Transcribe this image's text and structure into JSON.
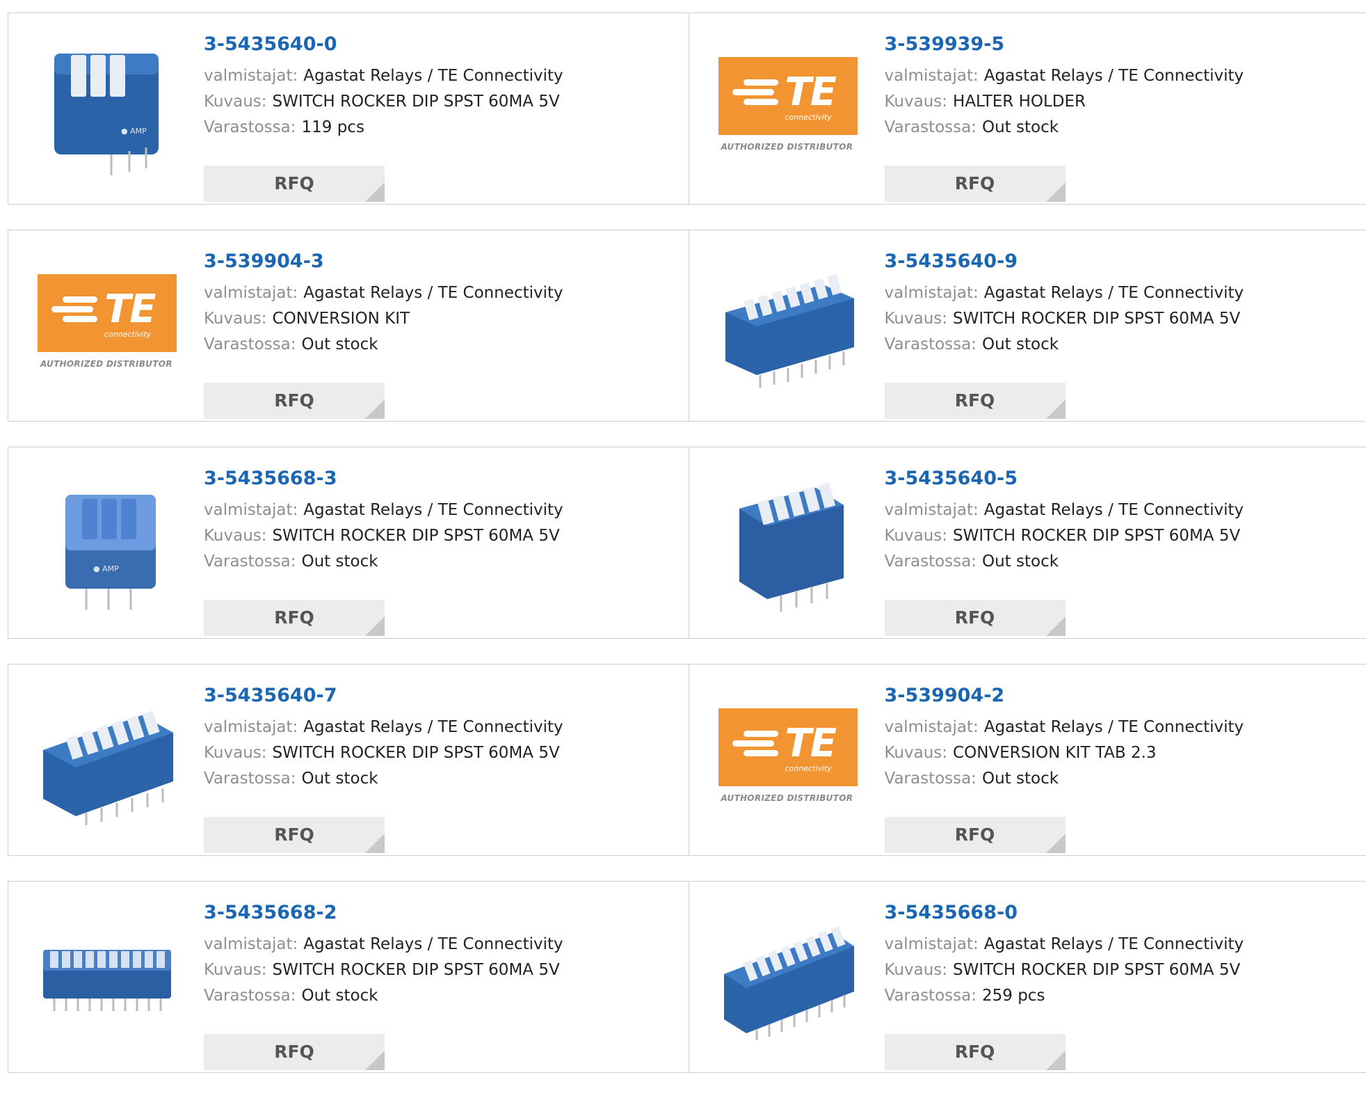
{
  "labels": {
    "manufacturer": "valmistajat:",
    "description": "Kuvaus:",
    "stock": "Varastossa:",
    "rfq": "RFQ"
  },
  "te_logo": {
    "brand": "TE",
    "sub": "connectivity",
    "distributor": "AUTHORIZED DISTRIBUTOR",
    "orange": "#f39433"
  },
  "link_color": "#1b66b3",
  "products": [
    {
      "part": "3-5435640-0",
      "manufacturer": "Agastat Relays / TE Connectivity",
      "description": "SWITCH ROCKER DIP SPST 60MA 5V",
      "stock": "119 pcs",
      "image": "dip-switch-3-position"
    },
    {
      "part": "3-539939-5",
      "manufacturer": "Agastat Relays / TE Connectivity",
      "description": "HALTER HOLDER",
      "stock": "Out stock",
      "image": "te-logo"
    },
    {
      "part": "3-539904-3",
      "manufacturer": "Agastat Relays / TE Connectivity",
      "description": "CONVERSION KIT",
      "stock": "Out stock",
      "image": "te-logo"
    },
    {
      "part": "3-5435640-9",
      "manufacturer": "Agastat Relays / TE Connectivity",
      "description": "SWITCH ROCKER DIP SPST 60MA 5V",
      "stock": "Out stock",
      "image": "dip-switch-7-position"
    },
    {
      "part": "3-5435668-3",
      "manufacturer": "Agastat Relays / TE Connectivity",
      "description": "SWITCH ROCKER DIP SPST 60MA 5V",
      "stock": "Out stock",
      "image": "dip-switch-3-position"
    },
    {
      "part": "3-5435640-5",
      "manufacturer": "Agastat Relays / TE Connectivity",
      "description": "SWITCH ROCKER DIP SPST 60MA 5V",
      "stock": "Out stock",
      "image": "dip-switch-5-position"
    },
    {
      "part": "3-5435640-7",
      "manufacturer": "Agastat Relays / TE Connectivity",
      "description": "SWITCH ROCKER DIP SPST 60MA 5V",
      "stock": "Out stock",
      "image": "dip-switch-6-position"
    },
    {
      "part": "3-539904-2",
      "manufacturer": "Agastat Relays / TE Connectivity",
      "description": "CONVERSION KIT TAB 2.3",
      "stock": "Out stock",
      "image": "te-logo"
    },
    {
      "part": "3-5435668-2",
      "manufacturer": "Agastat Relays / TE Connectivity",
      "description": "SWITCH ROCKER DIP SPST 60MA 5V",
      "stock": "Out stock",
      "image": "dip-switch-10-position"
    },
    {
      "part": "3-5435668-0",
      "manufacturer": "Agastat Relays / TE Connectivity",
      "description": "SWITCH ROCKER DIP SPST 60MA 5V",
      "stock": "259 pcs",
      "image": "dip-switch-8-position"
    }
  ]
}
